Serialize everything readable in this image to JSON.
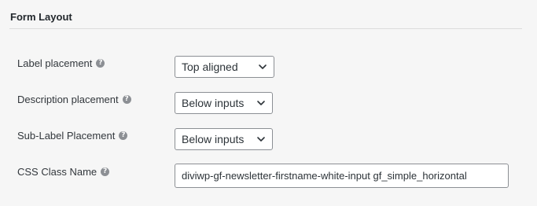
{
  "section": {
    "title": "Form Layout"
  },
  "rows": {
    "label_placement": {
      "label": "Label placement",
      "value": "Top aligned"
    },
    "description_placement": {
      "label": "Description placement",
      "value": "Below inputs"
    },
    "sublabel_placement": {
      "label": "Sub-Label Placement",
      "value": "Below inputs"
    },
    "css_class": {
      "label": "CSS Class Name",
      "value": "diviwp-gf-newsletter-firstname-white-input gf_simple_horizontal"
    }
  },
  "icons": {
    "help": "?",
    "help_name": "help-icon",
    "dropdown_name": "chevron-down-icon"
  },
  "colors": {
    "background": "#f6f6f6",
    "border": "#8c8f94",
    "help_icon": "#8c8f94"
  }
}
